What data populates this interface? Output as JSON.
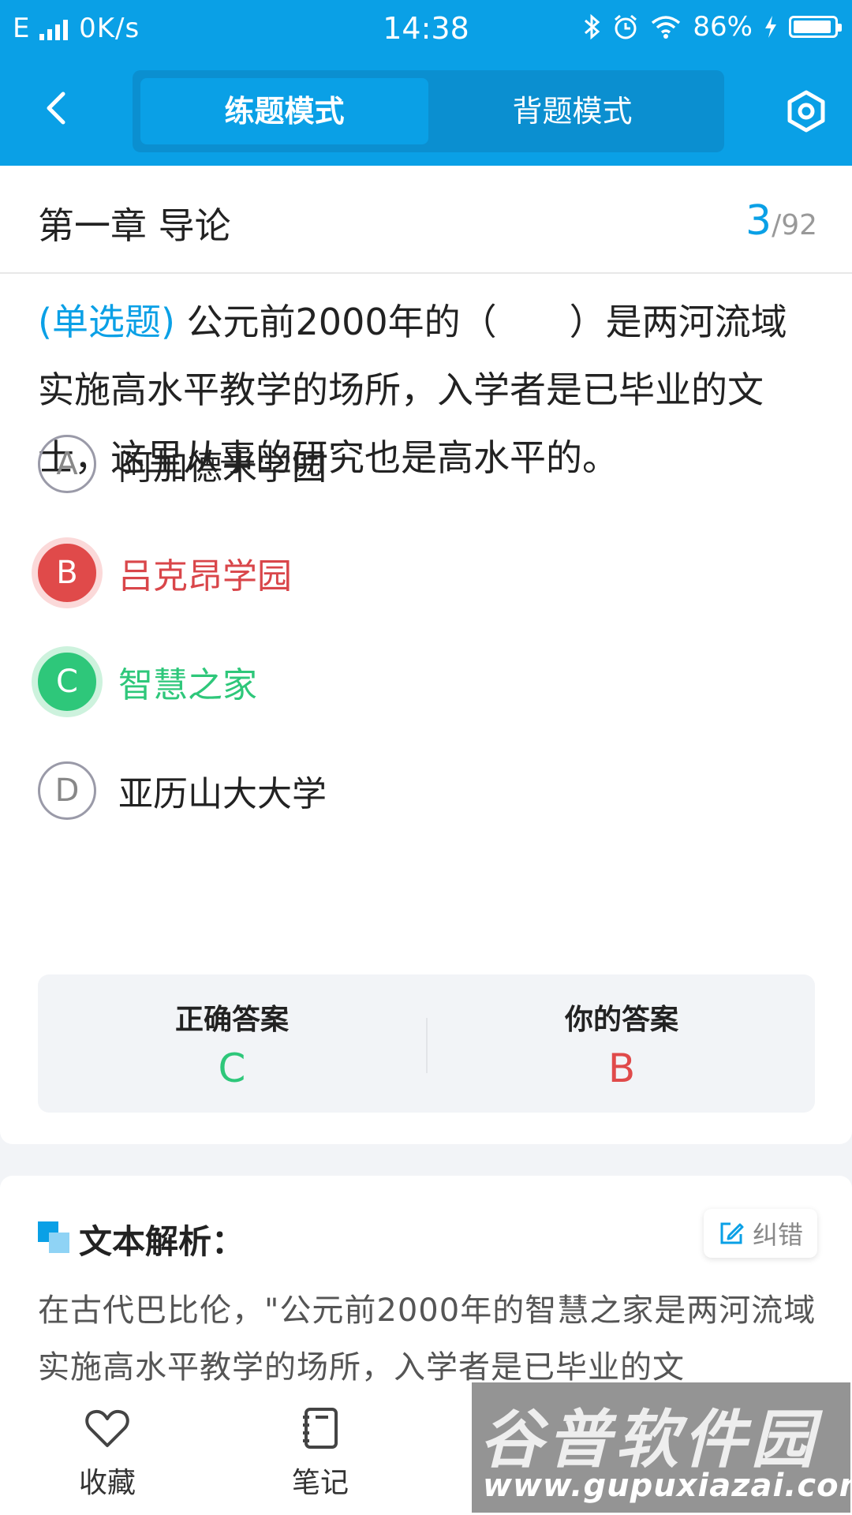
{
  "status_bar": {
    "network": "E",
    "speed": "0K/s",
    "time": "14:38",
    "battery": "86%"
  },
  "header": {
    "modes": [
      "练题模式",
      "背题模式"
    ],
    "active_mode": "练题模式"
  },
  "question_info": {
    "chapter": "第一章 导论",
    "current": "3",
    "total": "/92"
  },
  "question": {
    "type_tag": "(单选题)",
    "text": "公元前2000年的（　　）是两河流域实施高水平教学的场所，入学者是已毕业的文士，这里从事的研究也是高水平的。",
    "options": [
      {
        "letter": "A",
        "text": "阿加德米学园",
        "state": "normal"
      },
      {
        "letter": "B",
        "text": "吕克昂学园",
        "state": "wrong"
      },
      {
        "letter": "C",
        "text": "智慧之家",
        "state": "correct"
      },
      {
        "letter": "D",
        "text": "亚历山大大学",
        "state": "normal"
      }
    ]
  },
  "answers": {
    "correct_label": "正确答案",
    "correct_value": "C",
    "yours_label": "你的答案",
    "yours_value": "B"
  },
  "analysis": {
    "title": "文本解析：",
    "report_label": "纠错",
    "text": "在古代巴比伦，\"公元前2000年的智慧之家是两河流域实施高水平教学的场所，入学者是已毕业的文"
  },
  "bottom_bar": {
    "items": [
      {
        "label": "收藏",
        "icon": "heart-icon"
      },
      {
        "label": "笔记",
        "icon": "notebook-icon"
      }
    ]
  },
  "watermark": {
    "line1": "谷普软件园",
    "line2": "www.gupuxiazai.com"
  },
  "colors": {
    "primary": "#0aa0e6",
    "wrong": "#e04a4a",
    "correct": "#2ec77a"
  }
}
